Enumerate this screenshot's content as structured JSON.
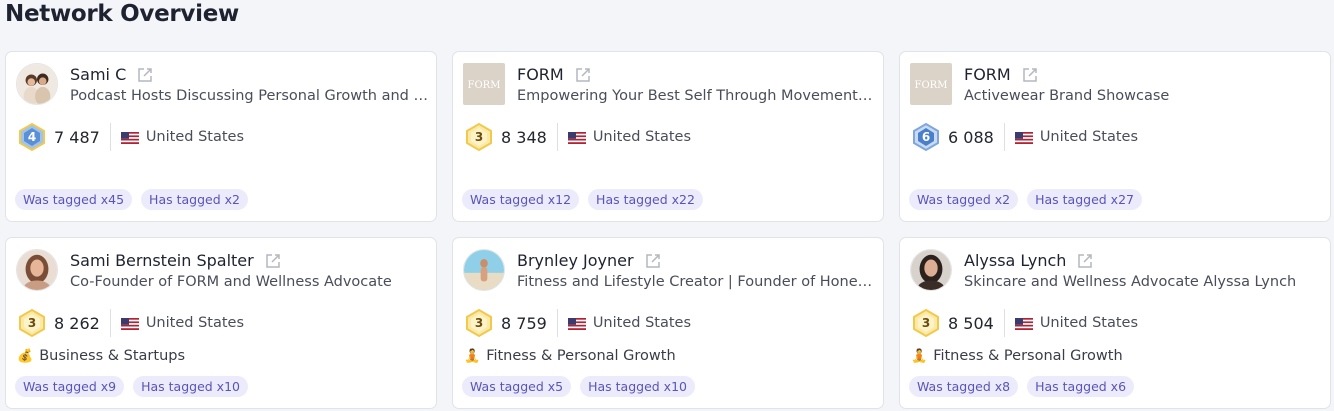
{
  "page": {
    "title": "Network Overview"
  },
  "profiles": [
    {
      "name": "Sami C",
      "bio": "Podcast Hosts Discussing Personal Growth and Wellness",
      "level": "4",
      "followers": "7 487",
      "country": "United States",
      "category": "",
      "was_tagged": "Was tagged x45",
      "has_tagged": "Has tagged x2"
    },
    {
      "name": "FORM",
      "bio": "Empowering Your Best Self Through Movement and Nutrition",
      "level": "3",
      "followers": "8 348",
      "country": "United States",
      "category": "",
      "avatar_text": "FORM",
      "was_tagged": "Was tagged x12",
      "has_tagged": "Has tagged x22"
    },
    {
      "name": "FORM",
      "bio": "Activewear Brand Showcase",
      "level": "6",
      "followers": "6 088",
      "country": "United States",
      "category": "",
      "avatar_text": "FORM",
      "was_tagged": "Was tagged x2",
      "has_tagged": "Has tagged x27"
    },
    {
      "name": "Sami Bernstein Spalter",
      "bio": "Co-Founder of FORM and Wellness Advocate",
      "level": "3",
      "followers": "8 262",
      "country": "United States",
      "category": "Business & Startups",
      "category_icon": "💰",
      "was_tagged": "Was tagged x9",
      "has_tagged": "Has tagged x10"
    },
    {
      "name": "Brynley Joyner",
      "bio": "Fitness and Lifestyle Creator | Founder of Honey Swim",
      "level": "3",
      "followers": "8 759",
      "country": "United States",
      "category": "Fitness & Personal Growth",
      "category_icon": "🧘",
      "was_tagged": "Was tagged x5",
      "has_tagged": "Has tagged x10"
    },
    {
      "name": "Alyssa Lynch",
      "bio": "Skincare and Wellness Advocate Alyssa Lynch",
      "level": "3",
      "followers": "8 504",
      "country": "United States",
      "category": "Fitness & Personal Growth",
      "category_icon": "🧘",
      "was_tagged": "Was tagged x8",
      "has_tagged": "Has tagged x6"
    }
  ],
  "icons": {
    "external": "external-link-icon",
    "flag": "us-flag-icon",
    "level_gold": "level-badge-gold-icon",
    "level_blue": "level-badge-blue-icon"
  },
  "colors": {
    "tag_bg": "#ecebfb",
    "tag_text": "#5b54b8",
    "badge_gold": "#f4d35e",
    "badge_blue": "#4a7fc9"
  }
}
